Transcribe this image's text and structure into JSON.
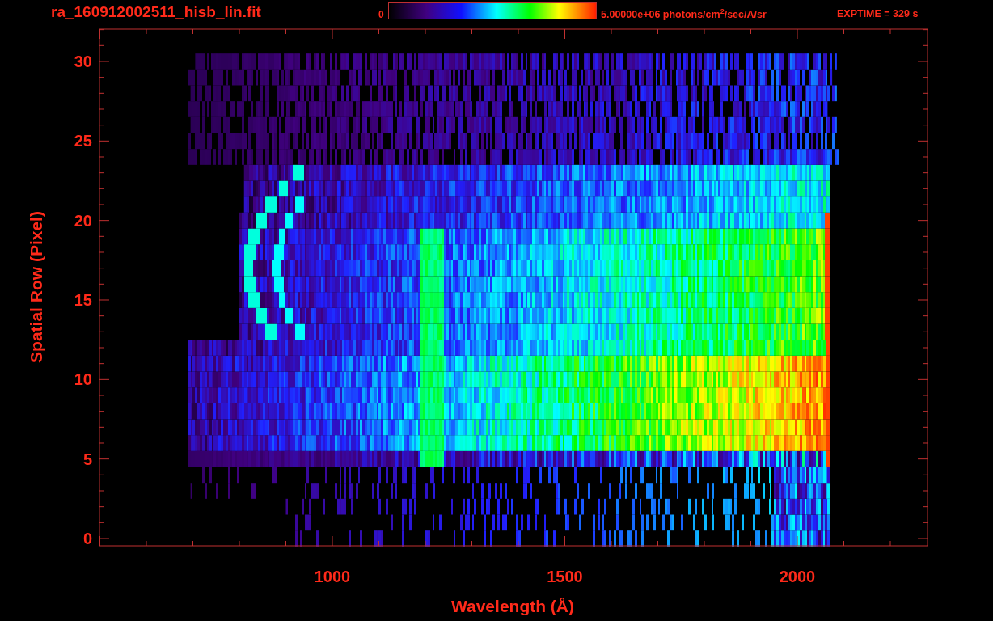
{
  "title": "ra_160912002511_hisb_lin.fit",
  "colorbar": {
    "min_label": "0",
    "max_label": "5.00000e+06 photons/cm$^{2}$/sec/A/sr"
  },
  "exposure": "EXPTIME = 329 s",
  "plot": {
    "ylabel": "Spatial Row (Pixel)",
    "xlabel": "Wavelength (Å)",
    "yticks": [
      "30",
      "25",
      "20",
      "15",
      "10",
      "5",
      "0"
    ],
    "xticks": [
      "1000",
      "1500",
      "2000"
    ]
  }
}
